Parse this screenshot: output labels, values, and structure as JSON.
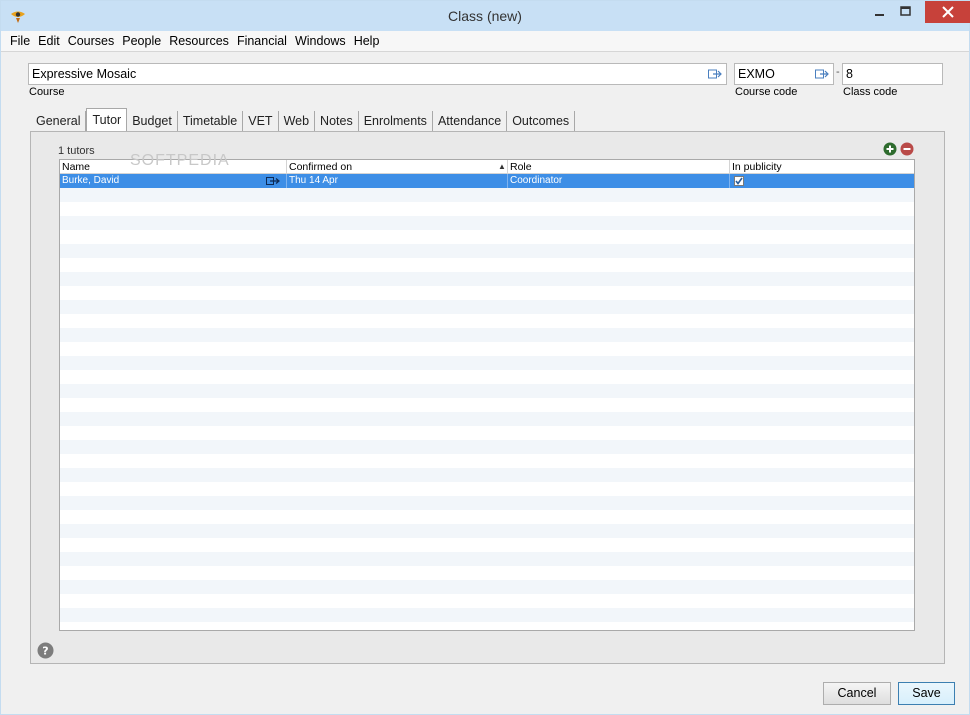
{
  "window": {
    "title": "Class (new)"
  },
  "menu": [
    "File",
    "Edit",
    "Courses",
    "People",
    "Resources",
    "Financial",
    "Windows",
    "Help"
  ],
  "course": {
    "value": "Expressive Mosaic",
    "label": "Course"
  },
  "course_code": {
    "value": "EXMO",
    "label": "Course code"
  },
  "class_code": {
    "value": "8",
    "label": "Class code"
  },
  "separator": "-",
  "tabs": [
    "General",
    "Tutor",
    "Budget",
    "Timetable",
    "VET",
    "Web",
    "Notes",
    "Enrolments",
    "Attendance",
    "Outcomes"
  ],
  "active_tab": "Tutor",
  "tutor_panel": {
    "count_text": "1 tutors",
    "columns": [
      "Name",
      "Confirmed on",
      "Role",
      "In publicity"
    ],
    "rows": [
      {
        "name": "Burke, David",
        "confirmed_on": "Thu 14 Apr",
        "role": "Coordinator",
        "in_publicity": true
      }
    ]
  },
  "buttons": {
    "cancel": "Cancel",
    "save": "Save"
  },
  "watermark": "SOFTPEDIA",
  "colors": {
    "accent": "#3d8ee6",
    "close": "#c7413a",
    "add": "#2d6b2d",
    "remove": "#b94a48"
  }
}
